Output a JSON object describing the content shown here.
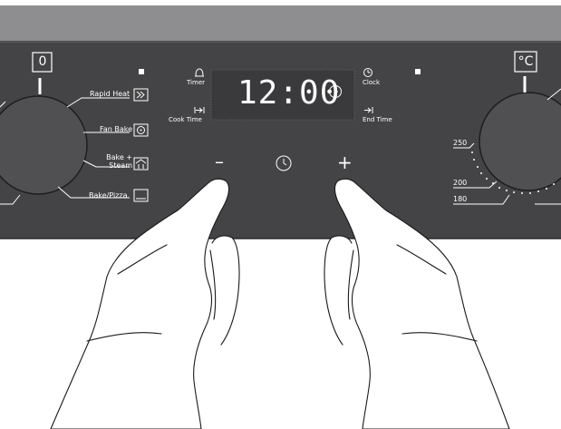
{
  "panel": {
    "colors": {
      "panel": "#444446",
      "top_strip": "#8e8e90",
      "knob": "#505052",
      "display": "#3a3a3c",
      "lines": "#ffffff"
    }
  },
  "left_knob": {
    "position_label": "0",
    "functions": [
      {
        "label": "Rapid Heat",
        "icon": "rapid-heat-icon"
      },
      {
        "label": "Fan Bake",
        "icon": "fan-bake-icon"
      },
      {
        "label_line1": "Bake +",
        "label_line2": "Steam",
        "icon": "bake-steam-icon"
      },
      {
        "label": "Bake/Pizza",
        "icon": "bake-pizza-icon"
      }
    ]
  },
  "display": {
    "time": "12:00",
    "timer_label": "Timer",
    "cook_time_label": "Cook Time",
    "clock_label": "Clock",
    "end_time_label": "End Time"
  },
  "controls": {
    "minus_symbol": "–",
    "plus_symbol": "+",
    "clock_button_icon": "clock-icon"
  },
  "right_knob": {
    "unit_label": "°C",
    "temperatures": [
      "250",
      "200",
      "180"
    ]
  },
  "hands": {
    "left_hand_icon": "pointing-hand-icon",
    "right_hand_icon": "pointing-hand-icon"
  }
}
